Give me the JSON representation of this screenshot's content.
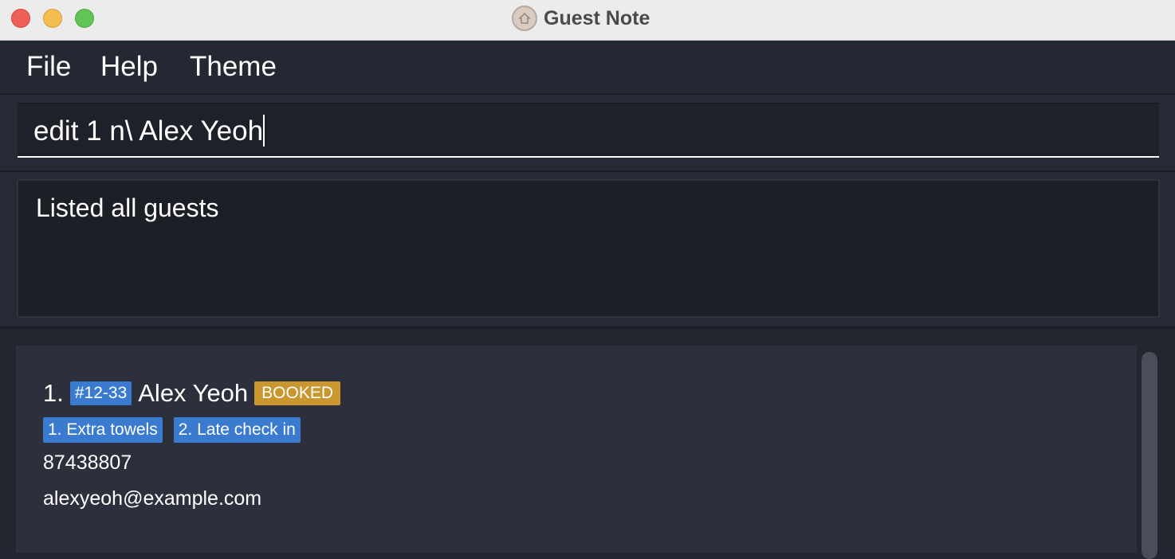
{
  "window": {
    "title": "Guest Note"
  },
  "menu": {
    "file": "File",
    "help": "Help",
    "theme": "Theme"
  },
  "command": {
    "value": "edit 1 n\\ Alex Yeoh"
  },
  "result": {
    "text": "Listed all guests"
  },
  "guests": [
    {
      "index": "1.",
      "room": "#12-33",
      "name": "Alex Yeoh",
      "status": "BOOKED",
      "requests": [
        "1. Extra towels",
        "2. Late check in"
      ],
      "phone": "87438807",
      "email": "alexyeoh@example.com"
    }
  ],
  "colors": {
    "tag_blue": "#3a7bd0",
    "status_booked": "#c9972d",
    "background": "#222630"
  }
}
